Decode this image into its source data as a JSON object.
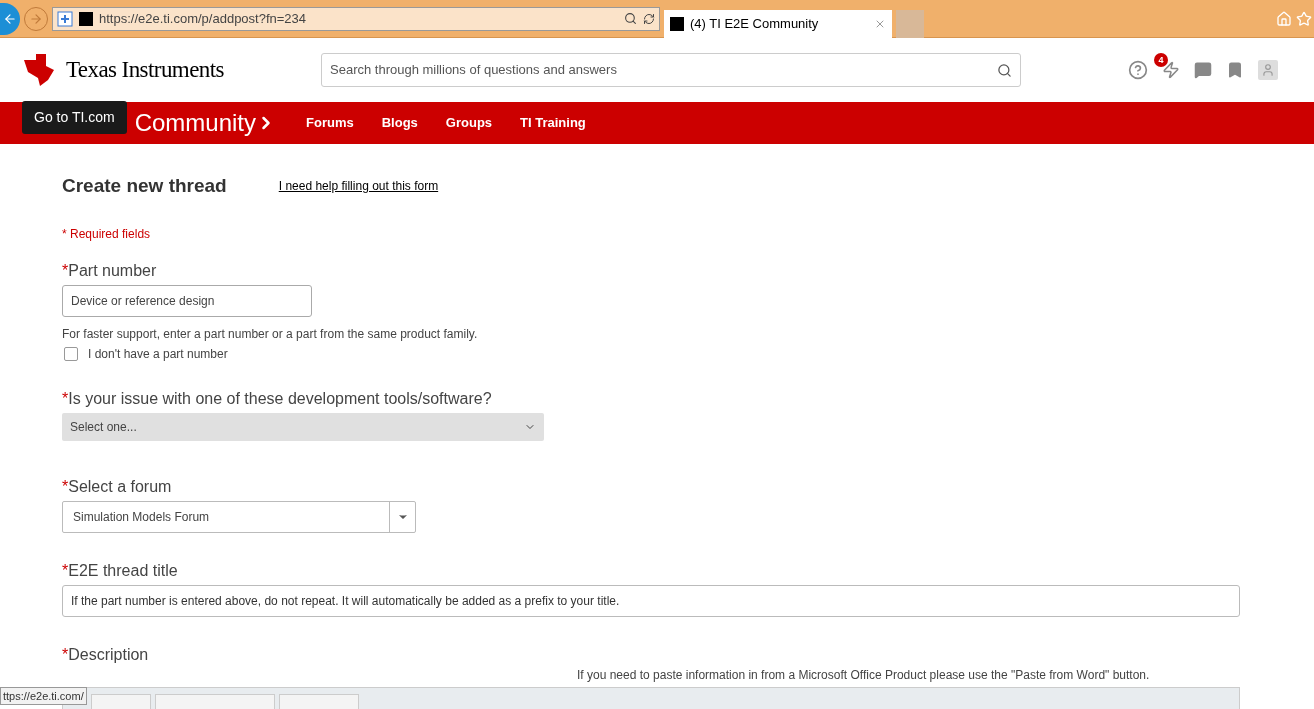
{
  "browser": {
    "url": "https://e2e.ti.com/p/addpost?fn=234",
    "tab": {
      "title": "(4) TI E2E Community",
      "selected": true
    }
  },
  "header": {
    "brand": "Texas Instruments",
    "search": {
      "placeholder": "Search through millions of questions and answers"
    },
    "notification_count": "4"
  },
  "nav": {
    "tooltip": "Go to TI.com",
    "community": "Community",
    "links": [
      "Forums",
      "Blogs",
      "Groups",
      "TI Training"
    ]
  },
  "form": {
    "title": "Create new thread",
    "help_link": "I need help filling out this form",
    "required_note": "* Required fields",
    "part_number": {
      "label": "Part number",
      "placeholder": "Device or reference design",
      "hint": "For faster support, enter a part number or a part from the same product family.",
      "checkbox": {
        "label": "I don't have a part number",
        "checked": false
      }
    },
    "tools": {
      "label": "Is your issue with one of these development tools/software?",
      "value": "Select one..."
    },
    "forum": {
      "label": "Select a forum",
      "value": "Simulation Models Forum"
    },
    "title_field": {
      "label": "E2E thread title",
      "placeholder": "If the part number is entered above, do not repeat. It will automatically be added as a prefix to your title."
    },
    "description": {
      "label": "Description",
      "note": "If you need to paste information in from a Microsoft Office Product please use the \"Paste from Word\" button."
    }
  },
  "status_url": "ttps://e2e.ti.com/",
  "required_mark": "*"
}
